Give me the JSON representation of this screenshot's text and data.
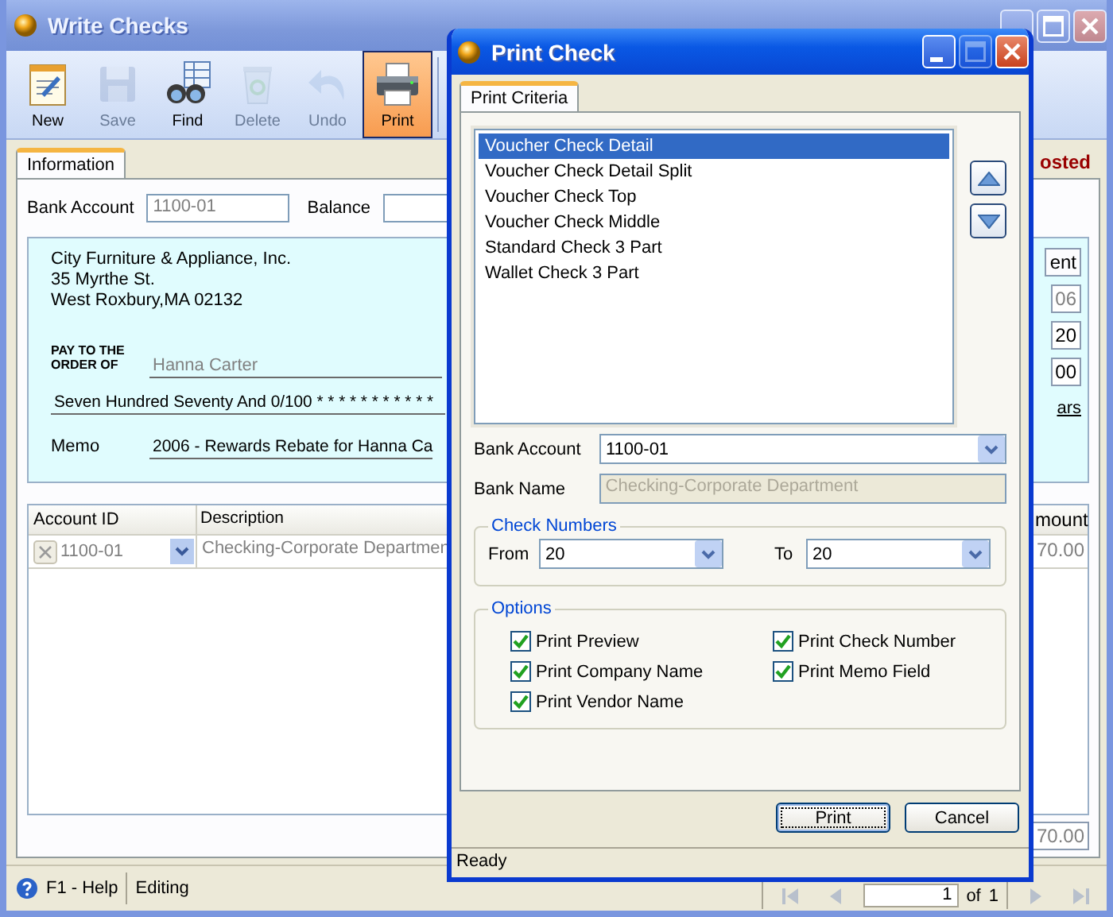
{
  "window": {
    "title": "Write Checks",
    "buttons": [
      {
        "kind": "minimize",
        "disabled": false
      },
      {
        "kind": "maximize",
        "disabled": false
      },
      {
        "kind": "close",
        "disabled": false
      }
    ]
  },
  "toolbar": [
    {
      "kind": "new",
      "label": "New",
      "disabled": false,
      "selected": false
    },
    {
      "kind": "save",
      "label": "Save",
      "disabled": true,
      "selected": false
    },
    {
      "kind": "find",
      "label": "Find",
      "disabled": false,
      "selected": false
    },
    {
      "kind": "delete",
      "label": "Delete",
      "disabled": true,
      "selected": false
    },
    {
      "kind": "undo",
      "label": "Undo",
      "disabled": true,
      "selected": false
    },
    {
      "kind": "print",
      "label": "Print",
      "disabled": false,
      "selected": true
    }
  ],
  "tabs": [
    {
      "label": "Information",
      "selected": true
    }
  ],
  "status_fragment": "osted",
  "bank_account": {
    "label": "Bank Account",
    "value": "1100-01"
  },
  "balance": {
    "label": "Balance"
  },
  "check": {
    "payer_lines": [
      "City Furniture & Appliance, Inc.",
      "35 Myrthe St.",
      "West Roxbury,MA 02132"
    ],
    "pay_to_lines": [
      "PAY TO THE",
      "ORDER OF"
    ],
    "payee": "Hanna  Carter",
    "amount_words": "Seven Hundred Seventy And 0/100 * * * * * * * * * * *",
    "memo_label": "Memo",
    "memo": "2006 - Rewards Rebate for Hanna  Ca",
    "right_button": "ent",
    "right_fields": [
      "06",
      "20",
      "00"
    ],
    "right_link": "ars"
  },
  "grid": {
    "columns": [
      "Account ID",
      "Description",
      "mount"
    ],
    "rows": [
      {
        "cells": [
          "1100-01",
          "Checking-Corporate Departmen",
          "70.00"
        ]
      }
    ],
    "total": "70.00"
  },
  "status_bar": {
    "help": "F1 - Help",
    "mode": "Editing",
    "page": "1",
    "of": "of",
    "count": "1",
    "nav": [
      {
        "kind": "first",
        "disabled": true
      },
      {
        "kind": "prev",
        "disabled": true
      },
      {
        "kind": "next",
        "disabled": true
      },
      {
        "kind": "last",
        "disabled": true
      }
    ]
  },
  "dialog": {
    "title": "Print Check",
    "buttons": [
      {
        "kind": "minimize",
        "disabled": false
      },
      {
        "kind": "maximize",
        "disabled": true
      },
      {
        "kind": "close",
        "disabled": false
      }
    ],
    "tabs": [
      {
        "label": "Print Criteria",
        "selected": true
      }
    ],
    "formats": [
      {
        "label": "Voucher Check Detail",
        "selected": true
      },
      {
        "label": "Voucher Check Detail Split",
        "selected": false
      },
      {
        "label": "Voucher Check Top",
        "selected": false
      },
      {
        "label": "Voucher Check Middle",
        "selected": false
      },
      {
        "label": "Standard Check 3 Part",
        "selected": false
      },
      {
        "label": "Wallet Check 3 Part",
        "selected": false
      }
    ],
    "bank_account": {
      "label": "Bank Account",
      "value": "1100-01"
    },
    "bank_name": {
      "label": "Bank Name",
      "value": "Checking-Corporate Department"
    },
    "check_numbers": {
      "title": "Check Numbers",
      "from_label": "From",
      "from": "20",
      "to_label": "To",
      "to": "20"
    },
    "options": {
      "title": "Options",
      "items": [
        {
          "label": "Print Preview",
          "checked": true
        },
        {
          "label": "Print Check Number",
          "checked": true
        },
        {
          "label": "Print Company Name",
          "checked": true
        },
        {
          "label": "Print Memo Field",
          "checked": true
        },
        {
          "label": "Print Vendor Name",
          "checked": true
        }
      ]
    },
    "actions": [
      {
        "label": "Print",
        "default": true
      },
      {
        "label": "Cancel",
        "default": false
      }
    ],
    "status": "Ready"
  }
}
